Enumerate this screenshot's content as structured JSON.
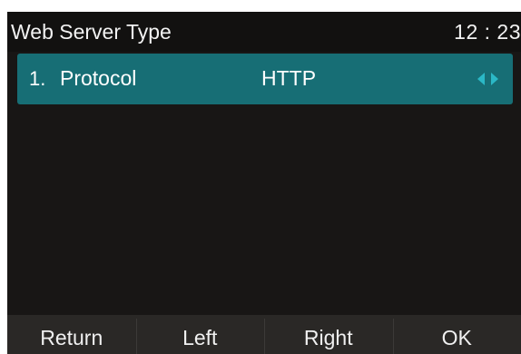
{
  "header": {
    "title": "Web Server Type",
    "time": "12 : 23"
  },
  "list": {
    "items": [
      {
        "index": "1.",
        "label": "Protocol",
        "value": "HTTP",
        "selected": true,
        "icons": [
          "arrow-left-icon",
          "arrow-right-icon"
        ]
      }
    ]
  },
  "softkeys": {
    "return_label": "Return",
    "left_label": "Left",
    "right_label": "Right",
    "ok_label": "OK"
  },
  "colors": {
    "background": "#181615",
    "selection": "#176e75",
    "arrow_accent": "#2bb8c6",
    "softkey_bar": "#2a2826"
  }
}
